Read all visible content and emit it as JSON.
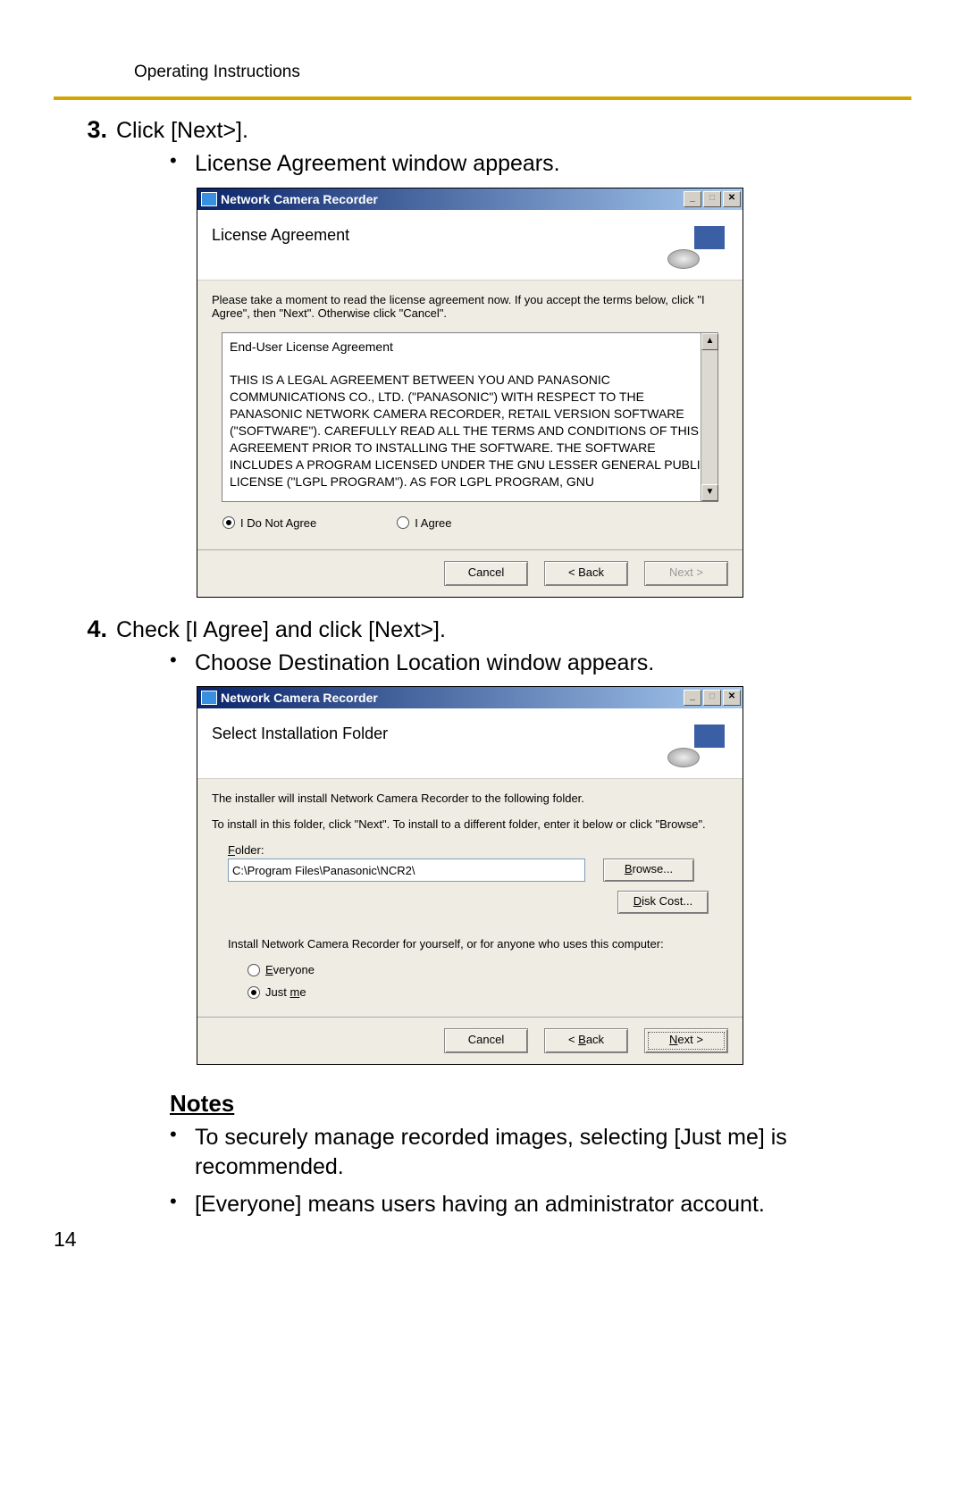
{
  "header": {
    "title": "Operating Instructions"
  },
  "steps": [
    {
      "num": "3.",
      "text": "Click [Next>].",
      "sub": "License Agreement window appears."
    },
    {
      "num": "4.",
      "text": "Check [I Agree] and click [Next>].",
      "sub": "Choose Destination Location window appears."
    }
  ],
  "dialog1": {
    "title": "Network Camera Recorder",
    "heading": "License Agreement",
    "instruction": "Please take a moment to read the license agreement now. If you accept the terms below, click \"I Agree\", then \"Next\". Otherwise click \"Cancel\".",
    "eula_line1": "End-User License Agreement",
    "eula_body": "THIS IS A LEGAL AGREEMENT BETWEEN YOU AND PANASONIC COMMUNICATIONS CO., LTD. (\"PANASONIC\") WITH RESPECT TO THE PANASONIC NETWORK CAMERA RECORDER, RETAIL VERSION SOFTWARE (\"SOFTWARE\"). CAREFULLY READ ALL THE TERMS AND CONDITIONS OF THIS AGREEMENT PRIOR TO INSTALLING THE SOFTWARE. THE SOFTWARE INCLUDES A PROGRAM LICENSED UNDER THE GNU LESSER GENERAL PUBLIC LICENSE (\"LGPL PROGRAM\"). AS FOR LGPL PROGRAM, GNU",
    "radio_no": "I Do Not Agree",
    "radio_yes": "I Agree",
    "btn_cancel": "Cancel",
    "btn_back": "< Back",
    "btn_next": "Next >"
  },
  "dialog2": {
    "title": "Network Camera Recorder",
    "heading": "Select Installation Folder",
    "line1": "The installer will install Network Camera Recorder to the following folder.",
    "line2": "To install in this folder, click \"Next\". To install to a different folder, enter it below or click \"Browse\".",
    "folder_label": "Folder:",
    "folder_value": "C:\\Program Files\\Panasonic\\NCR2\\",
    "btn_browse": "Browse...",
    "btn_diskcost": "Disk Cost...",
    "install_for": "Install Network Camera Recorder for yourself, or for anyone who uses this computer:",
    "radio_everyone": "Everyone",
    "radio_justme": "Just me",
    "btn_cancel": "Cancel",
    "btn_back": "< Back",
    "btn_next": "Next >"
  },
  "notes": {
    "heading": "Notes",
    "items": [
      "To securely manage recorded images, selecting [Just me] is recommended.",
      "[Everyone] means users having an administrator account."
    ]
  },
  "page_number": "14"
}
